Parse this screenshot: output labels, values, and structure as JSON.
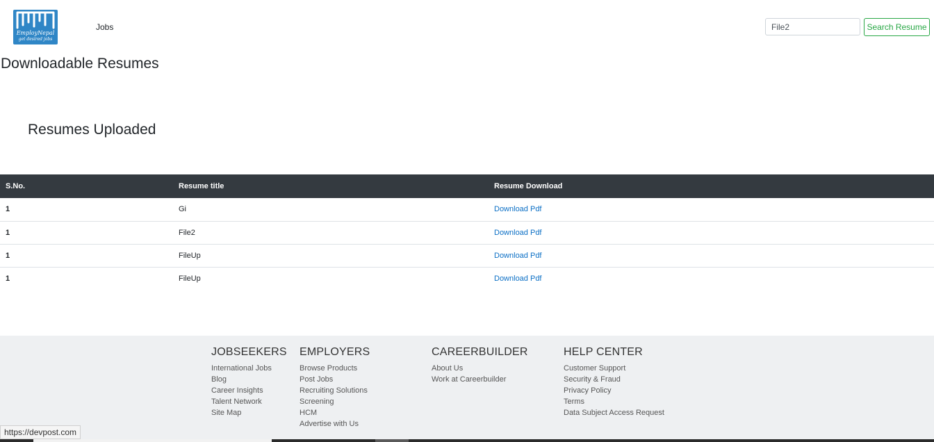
{
  "header": {
    "logo_text": "EmployNepal",
    "logo_tagline": "get desired jobs",
    "nav_jobs": "Jobs",
    "search_value": "File2",
    "search_button": "Search Resume"
  },
  "main": {
    "page_title": "Downloadable Resumes",
    "section_title": "Resumes Uploaded",
    "table": {
      "columns": [
        "S.No.",
        "Resume title",
        "Resume Download"
      ],
      "rows": [
        {
          "sno": "1",
          "title": "Gi",
          "download": "Download Pdf"
        },
        {
          "sno": "1",
          "title": "File2",
          "download": "Download Pdf"
        },
        {
          "sno": "1",
          "title": "FileUp",
          "download": "Download Pdf"
        },
        {
          "sno": "1",
          "title": "FileUp",
          "download": "Download Pdf"
        }
      ]
    }
  },
  "footer": {
    "columns": [
      {
        "heading": "JOBSEEKERS",
        "links": [
          "International Jobs",
          "Blog",
          "Career Insights",
          "Talent Network",
          "Site Map"
        ]
      },
      {
        "heading": "EMPLOYERS",
        "links": [
          "Browse Products",
          "Post Jobs",
          "Recruiting Solutions",
          "Screening",
          "HCM",
          "Advertise with Us"
        ]
      },
      {
        "heading": "CAREERBUILDER",
        "links": [
          "About Us",
          "Work at Careerbuilder"
        ]
      },
      {
        "heading": "HELP CENTER",
        "links": [
          "Customer Support",
          "Security & Fraud",
          "Privacy Policy",
          "Terms",
          "Data Subject Access Request"
        ]
      }
    ]
  },
  "status_bar": {
    "url": "https://devpost.com"
  },
  "colors": {
    "accent_green": "#28a745",
    "table_header": "#343a40",
    "link_blue": "#0b6fc5",
    "logo_blue": "#2f86c6",
    "footer_bg": "#eef0f2"
  }
}
